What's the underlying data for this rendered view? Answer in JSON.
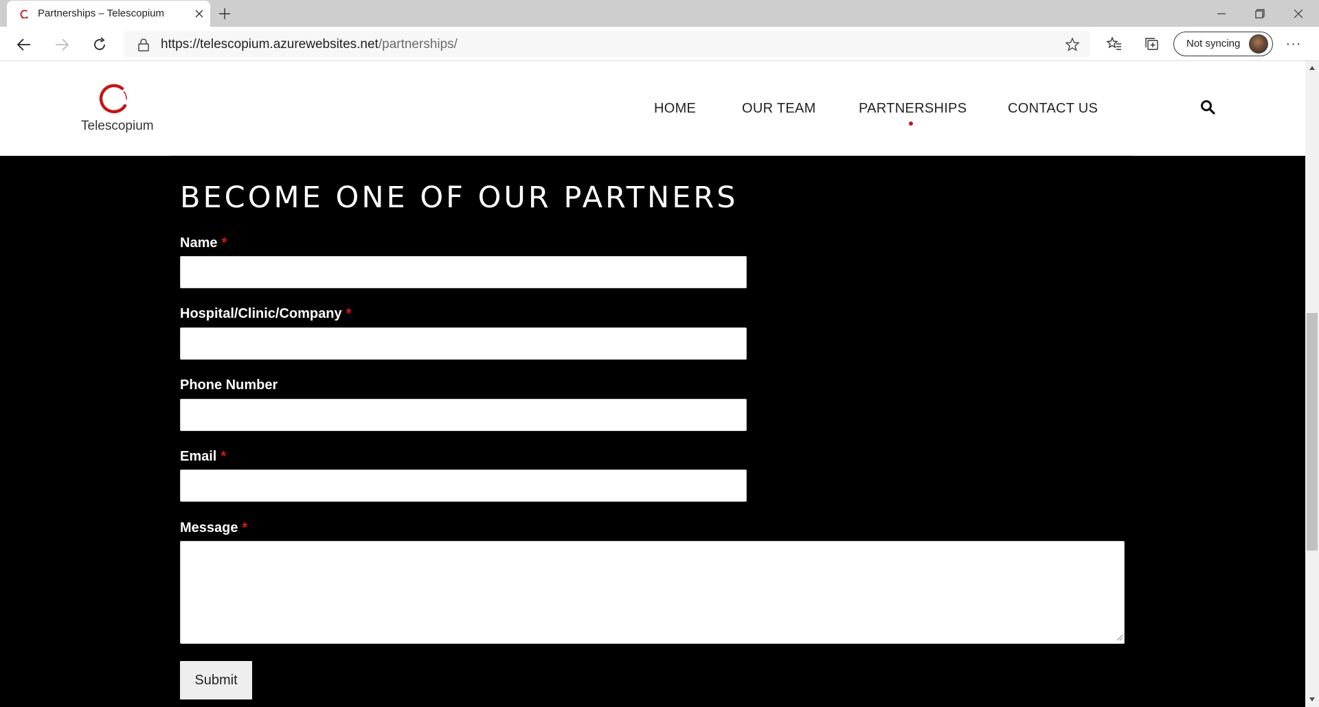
{
  "browser": {
    "tab_title": "Partnerships – Telescopium",
    "url_host": "https://telescopium.azurewebsites.net",
    "url_path": "/partnerships/",
    "sync_label": "Not syncing",
    "menu_label": "···"
  },
  "site": {
    "logo_text": "Telescopium",
    "nav": {
      "home": "HOME",
      "team": "OUR TEAM",
      "partnerships": "PARTNERSHIPS",
      "contact": "CONTACT US"
    },
    "active_nav": "PARTNERSHIPS",
    "accent_color": "#d10f0f"
  },
  "form": {
    "heading": "BECOME ONE OF OUR PARTNERS",
    "required_marker": "*",
    "name_label": "Name",
    "name_value": "",
    "company_label": "Hospital/Clinic/Company",
    "company_value": "",
    "phone_label": "Phone Number",
    "phone_value": "",
    "email_label": "Email",
    "email_value": "",
    "message_label": "Message",
    "message_value": "",
    "submit_label": "Submit"
  }
}
